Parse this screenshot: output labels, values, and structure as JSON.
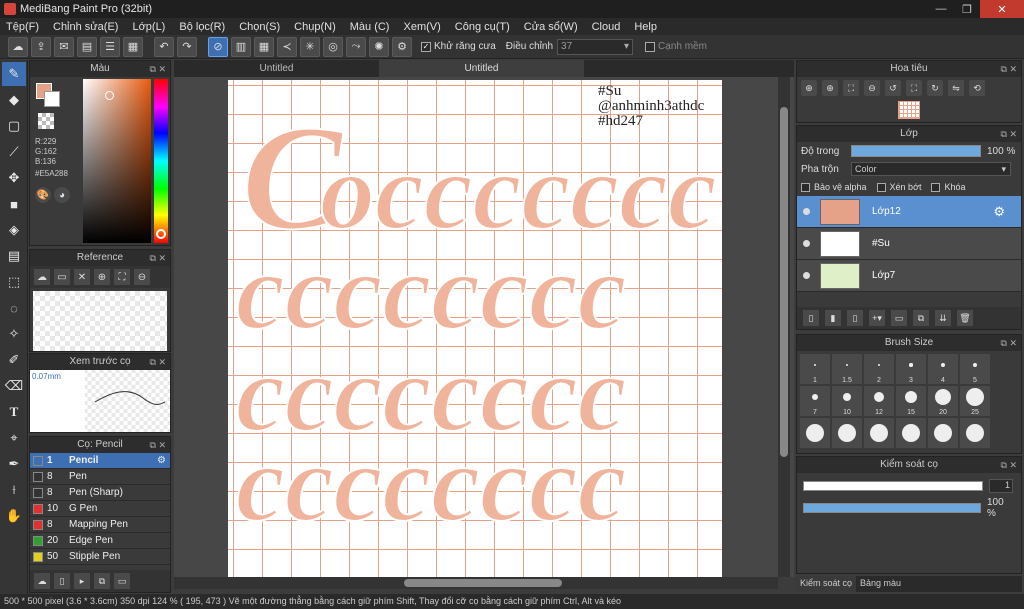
{
  "window": {
    "title": "MediBang Paint Pro (32bit)",
    "minimize": "—",
    "restore": "❐",
    "close": "✕"
  },
  "menu": [
    "Tệp(F)",
    "Chỉnh sửa(E)",
    "Lớp(L)",
    "Bộ lọc(R)",
    "Chọn(S)",
    "Chụp(N)",
    "Màu (C)",
    "Xem(V)",
    "Công cụ(T)",
    "Cửa sổ(W)",
    "Cloud",
    "Help"
  ],
  "toolbar": {
    "antialias_label": "Khử răng cưa",
    "adjust_label": "Điều chỉnh",
    "adjust_value": "37",
    "smooth_label": "Cạnh mềm"
  },
  "color": {
    "title": "Màu",
    "r": "R:229",
    "g": "G:162",
    "b": "B:136",
    "hex": "#E5A288",
    "fg_color": "#e5a288"
  },
  "reference": {
    "title": "Reference"
  },
  "preview": {
    "title": "Xem trước cọ",
    "size": "0.07mm"
  },
  "brushes": {
    "title": "Cọ: Pencil",
    "items": [
      {
        "size": "1",
        "name": "Pencil",
        "color": "#3e6fb3",
        "selected": true
      },
      {
        "size": "8",
        "name": "Pen",
        "color": "#333333"
      },
      {
        "size": "8",
        "name": "Pen (Sharp)",
        "color": "#333333"
      },
      {
        "size": "10",
        "name": "G Pen",
        "color": "#e03030"
      },
      {
        "size": "8",
        "name": "Mapping Pen",
        "color": "#e03030"
      },
      {
        "size": "20",
        "name": "Edge Pen",
        "color": "#30a030"
      },
      {
        "size": "50",
        "name": "Stipple Pen",
        "color": "#e0d020"
      }
    ]
  },
  "tabs": [
    "Untitled",
    "Untitled"
  ],
  "canvas": {
    "watermark": [
      "#Su",
      "@anhminh3athdc",
      "#hd247"
    ],
    "grid_color": "#e5a288",
    "letter_color": "#f0b39c"
  },
  "navigator": {
    "title": "Hoa tiêu"
  },
  "layers": {
    "title": "Lớp",
    "opacity_label": "Độ trong",
    "opacity_value": "100 %",
    "blend_label": "Pha trộn",
    "blend_value": "Color",
    "protect_alpha": "Bảo vệ alpha",
    "clipping": "Xén bớt",
    "lock": "Khóa",
    "items": [
      {
        "name": "Lớp12",
        "selected": true,
        "thumb": "#e5a288"
      },
      {
        "name": "#Su",
        "thumb": "#ffffff"
      },
      {
        "name": "Lớp7",
        "thumb": "#dff0c8"
      }
    ]
  },
  "brush_size": {
    "title": "Brush Size",
    "cells": [
      "1",
      "1.5",
      "2",
      "3",
      "4",
      "5",
      "7",
      "10",
      "12",
      "15",
      "20",
      "25",
      "",
      "",
      "",
      "",
      "",
      ""
    ]
  },
  "brush_control": {
    "title": "Kiểm soát cọ",
    "size_value": "1",
    "opacity_value": "100 %"
  },
  "bottom_tabs": [
    "Kiểm soát cọ",
    "Bảng màu"
  ],
  "status": "500 * 500 pixel  (3.6 * 3.6cm)  350 dpi  124 %  ( 195, 473 )  Vẽ một đường thẳng bằng cách giữ phím Shift, Thay đổi cỡ cọ bằng cách giữ phím Ctrl, Alt và kéo"
}
